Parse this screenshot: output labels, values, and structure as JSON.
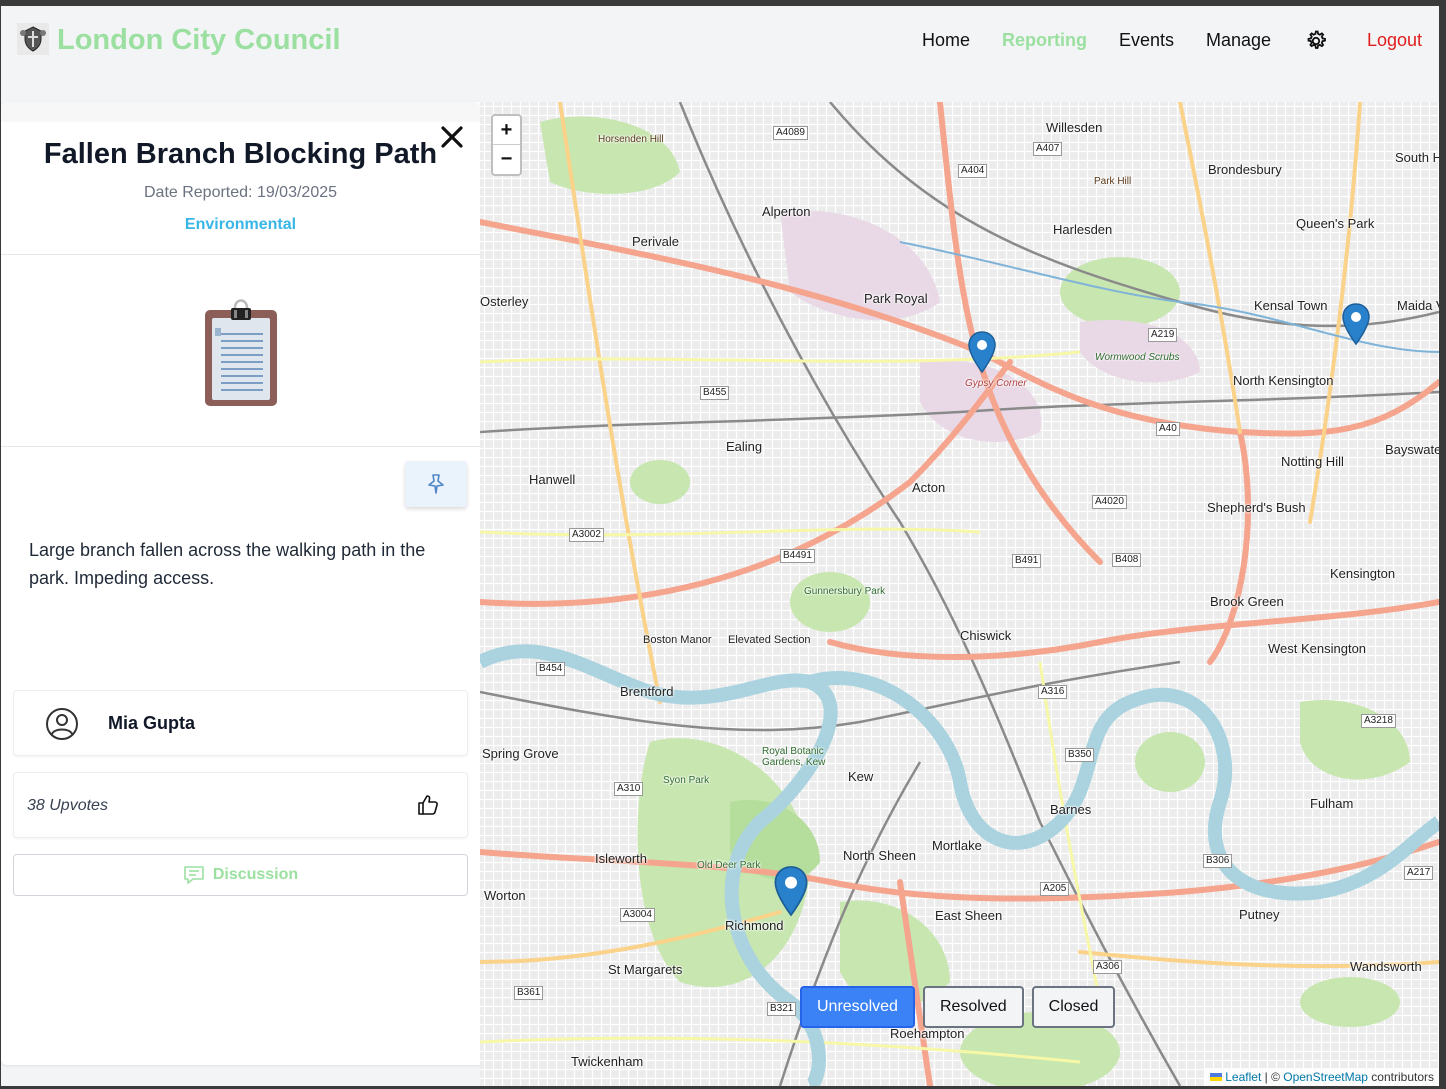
{
  "header": {
    "brand": "London City Council",
    "nav": {
      "home": "Home",
      "reporting": "Reporting",
      "events": "Events",
      "manage": "Manage",
      "logout": "Logout"
    }
  },
  "report": {
    "title": "Fallen Branch Blocking Path",
    "date": "Date Reported: 19/03/2025",
    "category": "Environmental",
    "description": "Large branch fallen across the walking path in the park. Impeding access.",
    "author": "Mia Gupta",
    "upvotes": "38 Upvotes",
    "discussion_label": "Discussion"
  },
  "map": {
    "zoom_in": "+",
    "zoom_out": "−",
    "places": [
      "Willesden",
      "Brondesbury",
      "Harlesden",
      "Queen's Park",
      "Alperton",
      "Perivale",
      "Park Royal",
      "Kensal Town",
      "Maida Vale",
      "North Kensington",
      "Gypsy Corner",
      "Wormwood Scrubs",
      "Notting Hill",
      "Ealing",
      "Hanwell",
      "Acton",
      "Shepherd's Bush",
      "Kensington",
      "Brook Green",
      "Chiswick",
      "West Kensington",
      "Gunnersbury Park",
      "Boston Manor",
      "Brentford",
      "Kew",
      "Barnes",
      "Fulham",
      "Spring Grove",
      "Isleworth",
      "Mortlake",
      "North Sheen",
      "Richmond",
      "East Sheen",
      "Putney",
      "St Margarets",
      "Twickenham",
      "Roehampton",
      "Wandsworth",
      "Osterley",
      "Syon Park",
      "Old Deer Park",
      "Royal Botanic Gardens, Kew",
      "Horsenden Hill",
      "Park Hill",
      "Worton",
      "South Hampstead",
      "Bayswater",
      "Elevated Section"
    ],
    "roads": [
      "A4089",
      "A407",
      "A404",
      "A219",
      "B455",
      "A40",
      "A4020",
      "A3002",
      "B4491",
      "B491",
      "B408",
      "A316",
      "B454",
      "B350",
      "A3218",
      "A310",
      "A205",
      "B306",
      "A3004",
      "A217",
      "A306",
      "B361",
      "B321"
    ],
    "filters": {
      "unresolved": "Unresolved",
      "resolved": "Resolved",
      "closed": "Closed"
    },
    "attribution": {
      "leaflet": "Leaflet",
      "sep": " | © ",
      "osm": "OpenStreetMap",
      "suffix": " contributors"
    }
  }
}
